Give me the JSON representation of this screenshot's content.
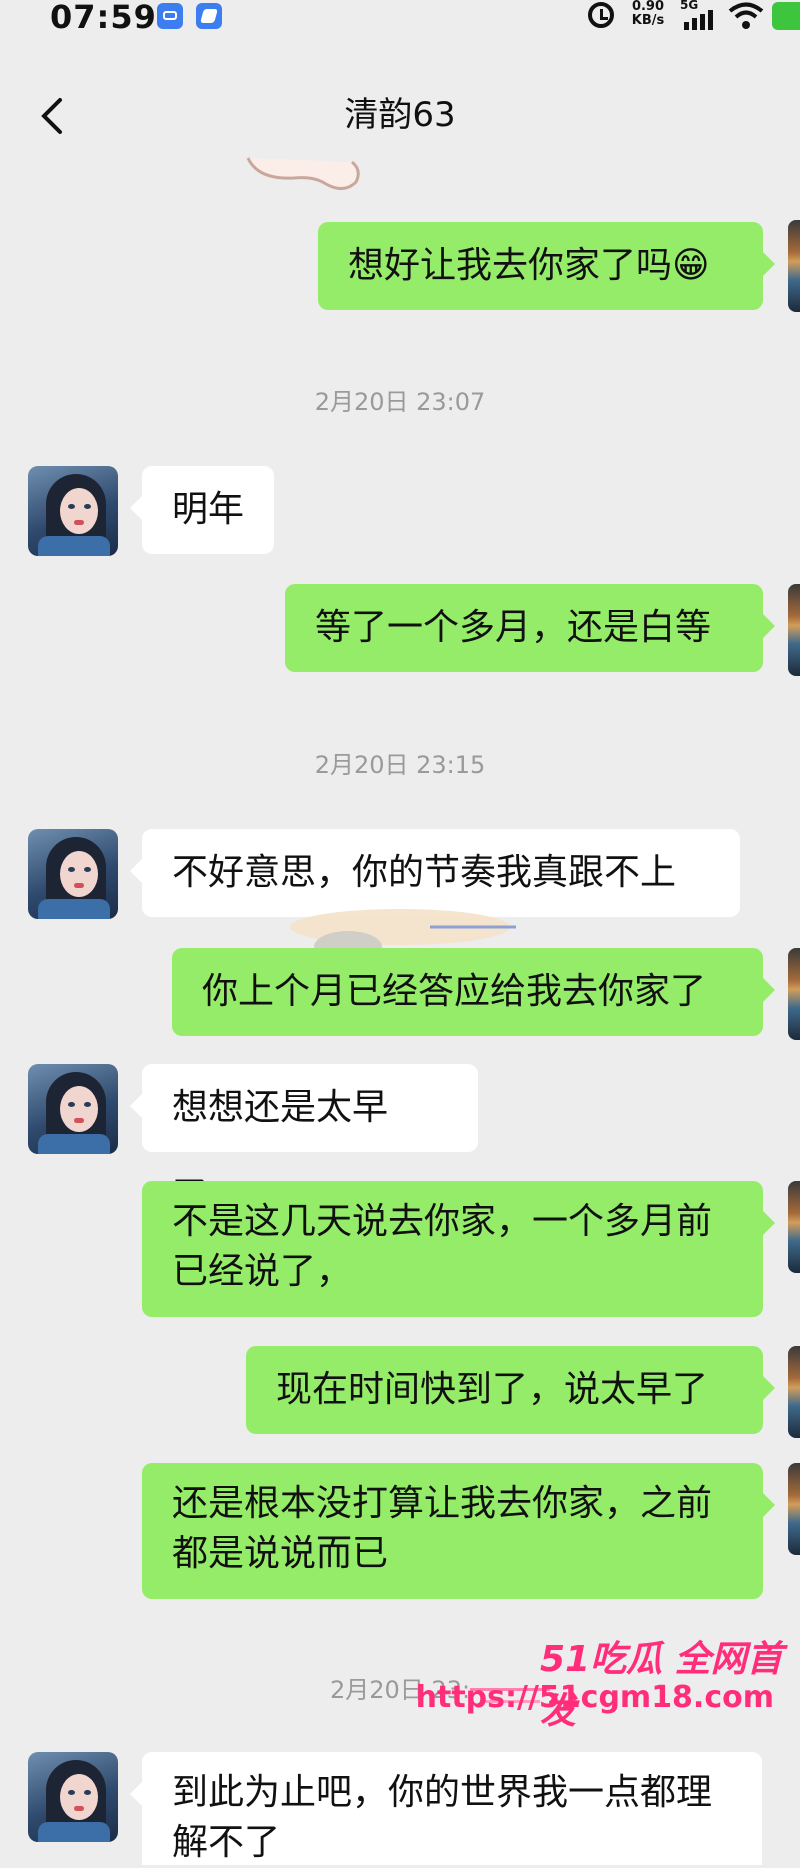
{
  "status_bar": {
    "time": "07:59",
    "net_speed_value": "0.90",
    "net_speed_unit": "KB/s",
    "network": "5G",
    "icons": [
      "app-icon",
      "app-icon",
      "alarm-icon",
      "signal-icon",
      "wifi-icon",
      "battery-icon"
    ]
  },
  "header": {
    "title": "清韵63",
    "back_icon": "chevron-left-icon"
  },
  "colors": {
    "background": "#ededed",
    "outgoing_bubble": "#95ec69",
    "incoming_bubble": "#ffffff",
    "timestamp_text": "#9a9a9a",
    "watermark": "#ff2d7a"
  },
  "messages": [
    {
      "side": "out",
      "text": "想好让我去你家了吗😁"
    },
    {
      "side": "time",
      "text": "2月20日 23:07"
    },
    {
      "side": "in",
      "text": "明年"
    },
    {
      "side": "out",
      "text": "等了一个多月，还是白等"
    },
    {
      "side": "time",
      "text": "2月20日 23:15"
    },
    {
      "side": "in",
      "text": "不好意思，你的节奏我真跟不上"
    },
    {
      "side": "out",
      "text": "你上个月已经答应给我去你家了"
    },
    {
      "side": "in",
      "text": "想想还是太早了，"
    },
    {
      "side": "out",
      "text": "不是这几天说去你家，一个多月前已经说了，"
    },
    {
      "side": "out",
      "text": "现在时间快到了，说太早了"
    },
    {
      "side": "out",
      "text": "还是根本没打算让我去你家，之前都是说说而已"
    },
    {
      "side": "time",
      "text": "2月20日 23:"
    },
    {
      "side": "in",
      "text": "到此为止吧，你的世界我一点都理解不了"
    }
  ],
  "watermark": {
    "title": "51吃瓜 全网首发",
    "url": "https://51cgm18.com"
  }
}
